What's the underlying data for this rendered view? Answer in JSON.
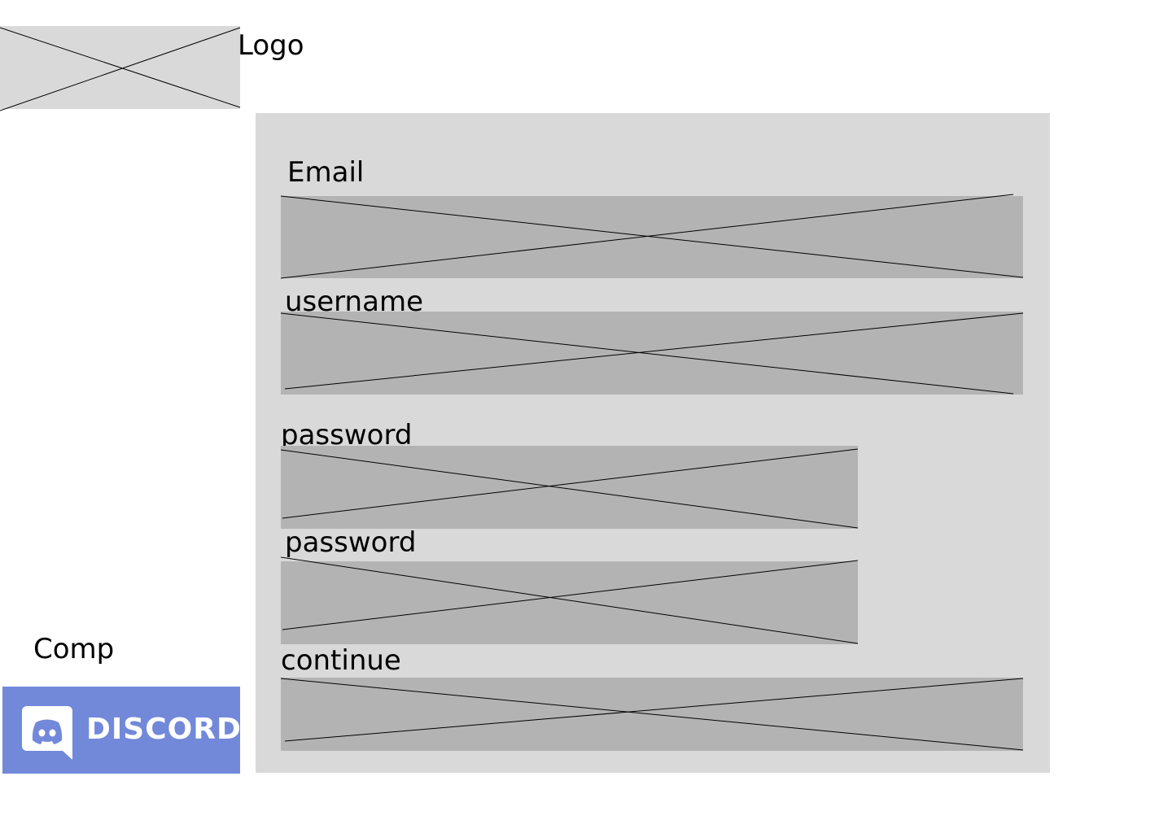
{
  "logo": {
    "label": "Logo"
  },
  "form": {
    "email_label": "Email",
    "username_label": "username",
    "password_label": "password",
    "confirm_password_label": "password",
    "continue_label": "continue"
  },
  "footer": {
    "comp_label": "Comp",
    "discord_wordmark": "DISCORD",
    "discord_icon": "discord-icon"
  },
  "colors": {
    "placeholder": "#d9d9d9",
    "field": "#b3b3b3",
    "discord_brand": "#7289da"
  }
}
